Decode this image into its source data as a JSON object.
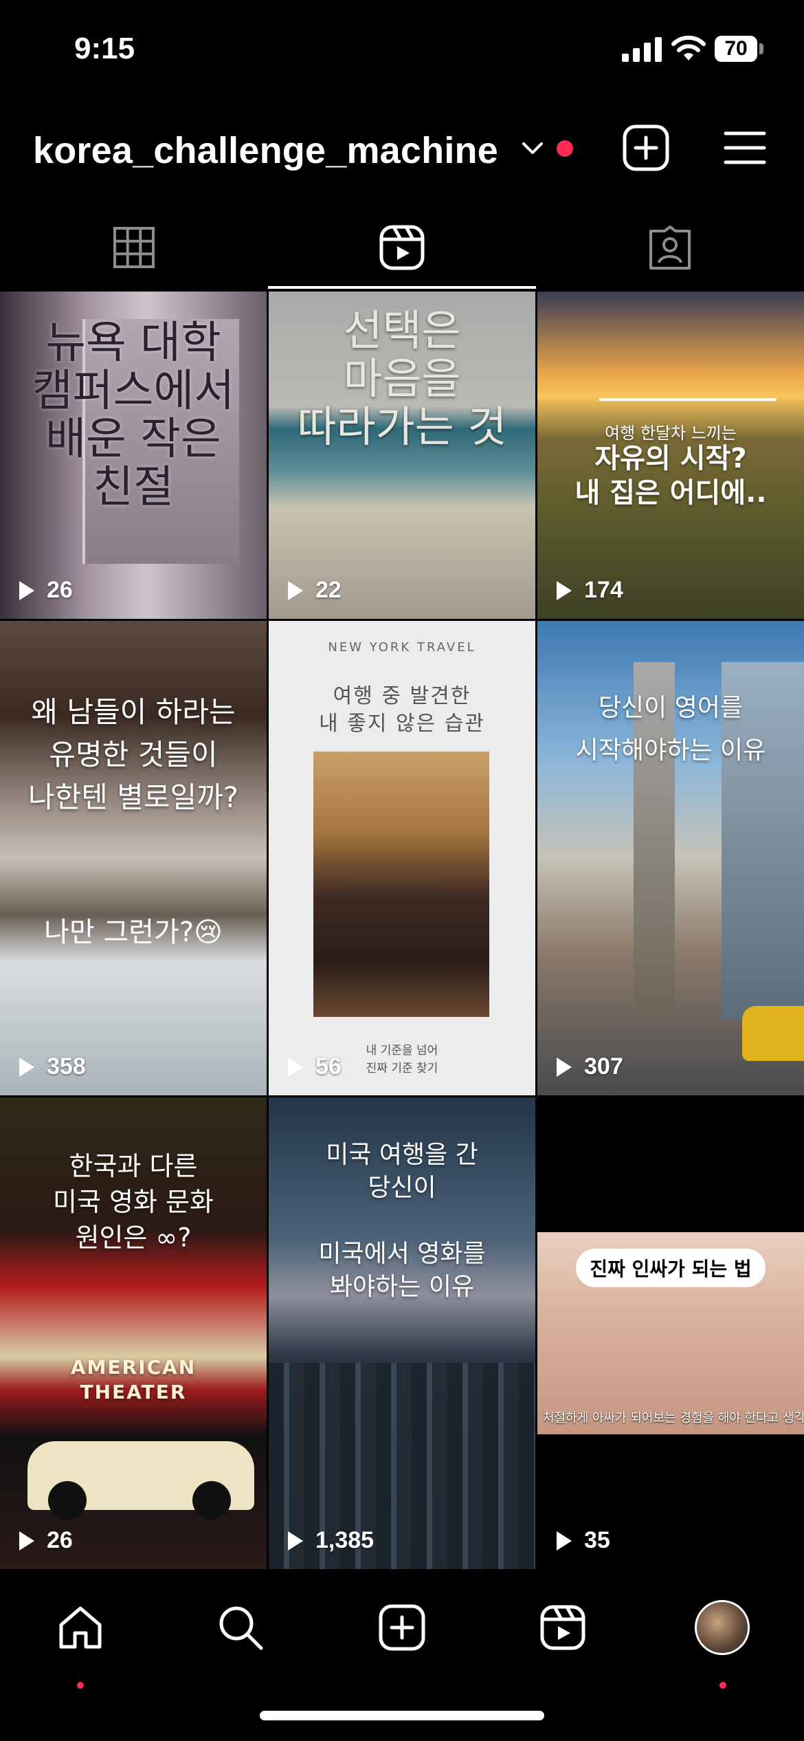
{
  "status_bar": {
    "time": "9:15",
    "battery": "70"
  },
  "header": {
    "username": "korea_challenge_machine"
  },
  "tabs": [
    {
      "id": "grid",
      "icon": "grid-icon",
      "active": false
    },
    {
      "id": "reels",
      "icon": "reels-icon",
      "active": true
    },
    {
      "id": "tagged",
      "icon": "tagged-icon",
      "active": false
    }
  ],
  "reels": [
    {
      "caption": "뉴욕 대학\n캠퍼스에서\n배운 작은\n친절",
      "views": "26"
    },
    {
      "caption": "선택은\n마음을\n따라가는 것",
      "views": "22"
    },
    {
      "caption_small": "여행 한달차 느끼는",
      "caption": "자유의 시작?\n내 집은 어디에..",
      "views": "174"
    },
    {
      "caption": "왜 남들이 하라는\n유명한 것들이\n나한텐 별로일까?",
      "caption2": "나만 그런가?",
      "emoji": "😢",
      "views": "358"
    },
    {
      "caption_small": "NEW YORK TRAVEL",
      "caption": "여행 중 발견한\n내 좋지 않은 습관",
      "footer": "내 기준을 넘어\n진짜 기준 찾기",
      "views": "56"
    },
    {
      "caption": "당신이 영어를\n시작해야하는 이유",
      "views": "307"
    },
    {
      "caption": "한국과 다른\n미국 영화 문화\n원인은 ∞?",
      "sign": "AMERICAN\nTHEATER",
      "views": "26"
    },
    {
      "caption": "미국 여행을 간\n당신이\n\n미국에서 영화를\n봐야하는 이유",
      "views": "1,385"
    },
    {
      "caption": "진짜 인싸가 되는 법",
      "subtitle": "처절하게 아싸가 되어보는 경험을 해야 한다고 생각해",
      "views": "35"
    }
  ],
  "colors": {
    "accent_red": "#ff2d55",
    "background": "#000000",
    "text": "#ffffff"
  }
}
